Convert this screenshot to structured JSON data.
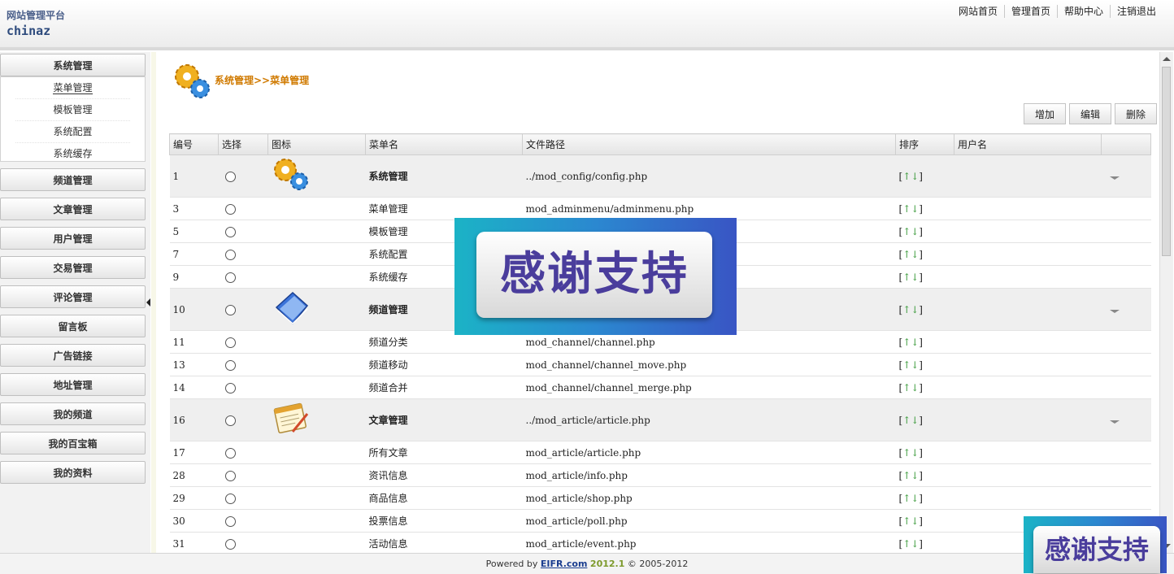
{
  "header": {
    "site_title": "网站管理平台",
    "site_name": "chinaz",
    "nav": [
      "网站首页",
      "管理首页",
      "帮助中心",
      "注销退出"
    ]
  },
  "sidebar": {
    "expanded": {
      "label": "系统管理",
      "items": [
        "菜单管理",
        "模板管理",
        "系统配置",
        "系统缓存"
      ],
      "active": "菜单管理"
    },
    "sections": [
      "频道管理",
      "文章管理",
      "用户管理",
      "交易管理",
      "评论管理",
      "留言板",
      "广告链接",
      "地址管理",
      "我的频道",
      "我的百宝箱",
      "我的资料"
    ]
  },
  "breadcrumb": "系统管理>>菜单管理",
  "toolbar": {
    "add": "增加",
    "edit": "编辑",
    "delete": "删除"
  },
  "table": {
    "headers": [
      "编号",
      "选择",
      "图标",
      "菜单名",
      "文件路径",
      "排序",
      "用户名",
      ""
    ],
    "sort_text": "[↑↓]",
    "rows": [
      {
        "id": "1",
        "name": "系统管理",
        "path": "../mod_config/config.php",
        "parent": true,
        "icon": "gears-icon"
      },
      {
        "id": "3",
        "name": "菜单管理",
        "path": "mod_adminmenu/adminmenu.php",
        "parent": false
      },
      {
        "id": "5",
        "name": "模板管理",
        "path": "",
        "parent": false
      },
      {
        "id": "7",
        "name": "系统配置",
        "path": "",
        "parent": false
      },
      {
        "id": "9",
        "name": "系统缓存",
        "path": "",
        "parent": false
      },
      {
        "id": "10",
        "name": "频道管理",
        "path": "",
        "parent": true,
        "icon": "folder-icon"
      },
      {
        "id": "11",
        "name": "频道分类",
        "path": "mod_channel/channel.php",
        "parent": false
      },
      {
        "id": "13",
        "name": "频道移动",
        "path": "mod_channel/channel_move.php",
        "parent": false
      },
      {
        "id": "14",
        "name": "频道合并",
        "path": "mod_channel/channel_merge.php",
        "parent": false
      },
      {
        "id": "16",
        "name": "文章管理",
        "path": "../mod_article/article.php",
        "parent": true,
        "icon": "notepad-icon"
      },
      {
        "id": "17",
        "name": "所有文章",
        "path": "mod_article/article.php",
        "parent": false
      },
      {
        "id": "28",
        "name": "资讯信息",
        "path": "mod_article/info.php",
        "parent": false
      },
      {
        "id": "29",
        "name": "商品信息",
        "path": "mod_article/shop.php",
        "parent": false
      },
      {
        "id": "30",
        "name": "投票信息",
        "path": "mod_article/poll.php",
        "parent": false
      },
      {
        "id": "31",
        "name": "活动信息",
        "path": "mod_article/event.php",
        "parent": false
      }
    ]
  },
  "footer": {
    "prefix": "Powered by",
    "link": "EIFR.com",
    "version": "2012.1",
    "copyright": "© 2005-2012"
  },
  "overlay": {
    "text": "感谢支持"
  },
  "colors": {
    "breadcrumb": "#d07a00",
    "sort_arrow": "#3a9a3a",
    "link": "#1a3d8f"
  }
}
